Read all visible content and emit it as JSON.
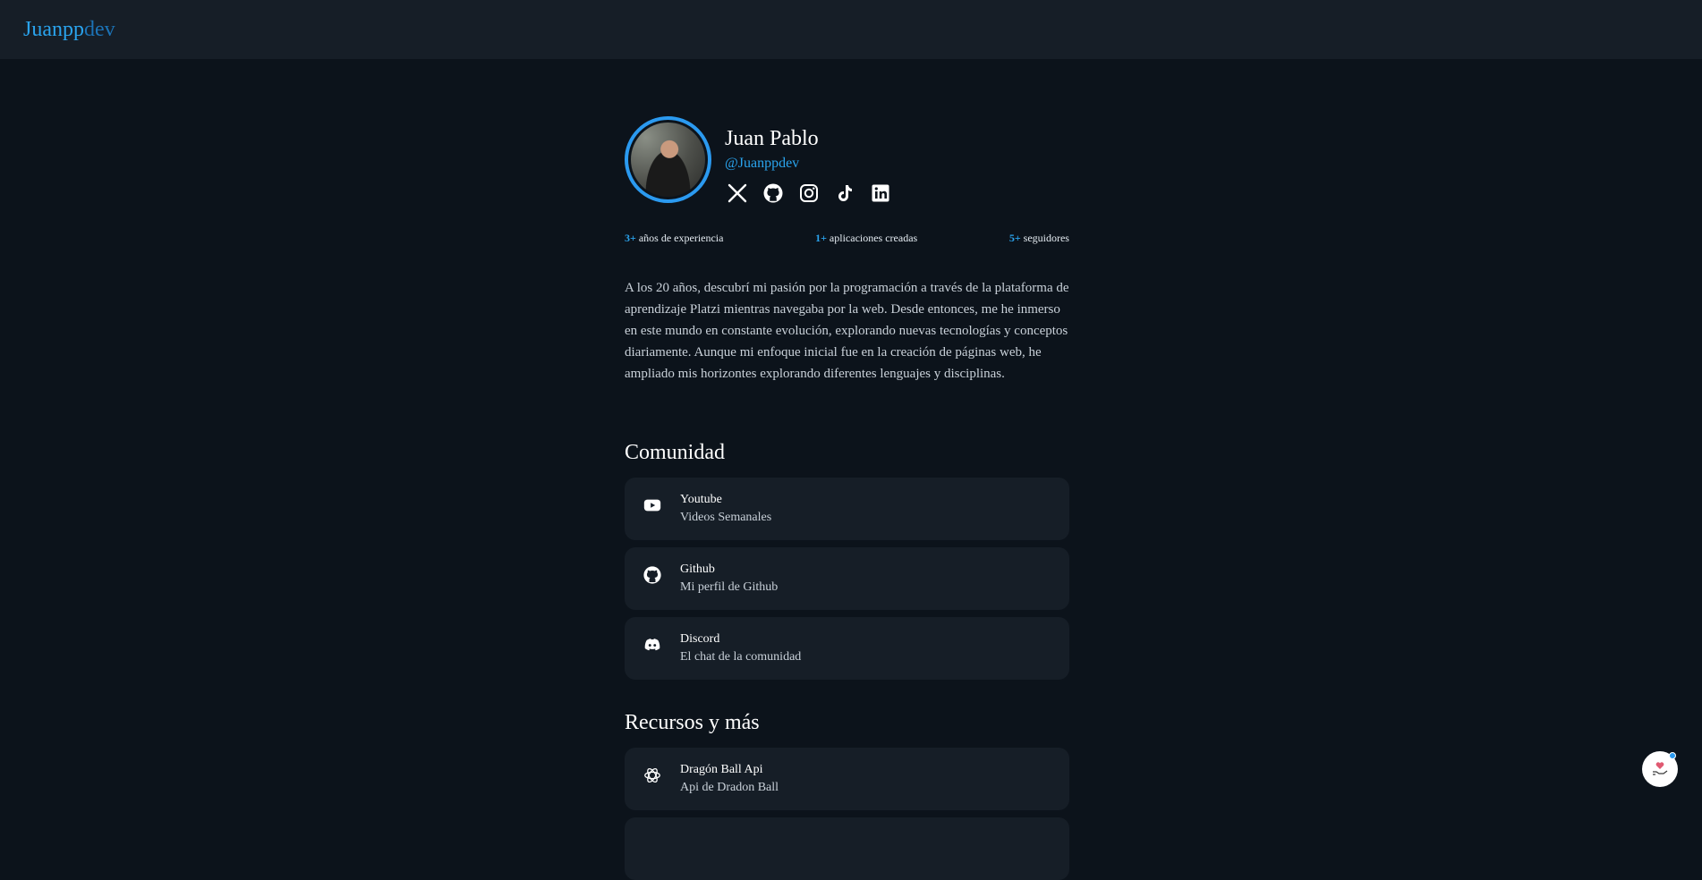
{
  "brand": {
    "part1": "Juanpp",
    "part2": "dev"
  },
  "profile": {
    "name": "Juan Pablo",
    "handle": "@Juanppdev",
    "socials": [
      "x-icon",
      "github-icon",
      "instagram-icon",
      "tiktok-icon",
      "linkedin-icon"
    ]
  },
  "stats": [
    {
      "value": "3+",
      "label": "años de experiencia"
    },
    {
      "value": "1+",
      "label": "aplicaciones creadas"
    },
    {
      "value": "5+",
      "label": "seguidores"
    }
  ],
  "bio": "A los 20 años, descubrí mi pasión por la programación a través de la plataforma de aprendizaje Platzi mientras navegaba por la web. Desde entonces, me he inmerso en este mundo en constante evolución, explorando nuevas tecnologías y conceptos diariamente. Aunque mi enfoque inicial fue en la creación de páginas web, he ampliado mis horizontes explorando diferentes lenguajes y disciplinas.",
  "community": {
    "title": "Comunidad",
    "items": [
      {
        "title": "Youtube",
        "subtitle": "Videos Semanales",
        "icon": "youtube-icon"
      },
      {
        "title": "Github",
        "subtitle": "Mi perfil de Github",
        "icon": "github-icon"
      },
      {
        "title": "Discord",
        "subtitle": "El chat de la comunidad",
        "icon": "discord-icon"
      }
    ]
  },
  "resources": {
    "title": "Recursos y más",
    "items": [
      {
        "title": "Dragón Ball Api",
        "subtitle": "Api de Dradon Ball",
        "icon": "openai-icon"
      }
    ]
  },
  "colors": {
    "accent": "#2aa4ee",
    "background": "#0c131b",
    "card": "#161e27"
  }
}
